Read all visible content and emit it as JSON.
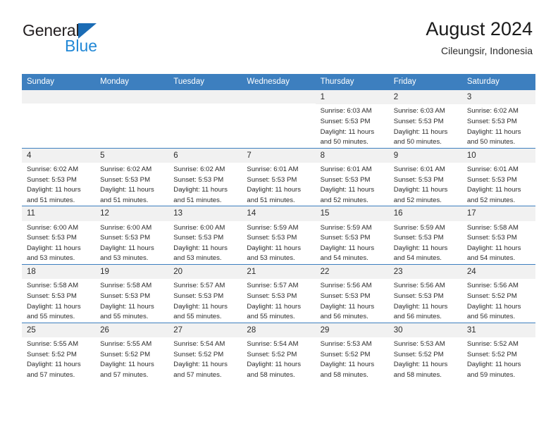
{
  "brand": {
    "name_part1": "General",
    "name_part2": "Blue",
    "accent_color": "#2288d6",
    "mark_color": "#1b6cb5"
  },
  "header": {
    "title": "August 2024",
    "subtitle": "Cileungsir, Indonesia"
  },
  "calendar": {
    "header_bg": "#3d7fbf",
    "daynum_bg": "#f1f1f1",
    "weekdays": [
      "Sunday",
      "Monday",
      "Tuesday",
      "Wednesday",
      "Thursday",
      "Friday",
      "Saturday"
    ],
    "weeks": [
      [
        {
          "day": "",
          "sunrise": "",
          "sunset": "",
          "daylight1": "",
          "daylight2": ""
        },
        {
          "day": "",
          "sunrise": "",
          "sunset": "",
          "daylight1": "",
          "daylight2": ""
        },
        {
          "day": "",
          "sunrise": "",
          "sunset": "",
          "daylight1": "",
          "daylight2": ""
        },
        {
          "day": "",
          "sunrise": "",
          "sunset": "",
          "daylight1": "",
          "daylight2": ""
        },
        {
          "day": "1",
          "sunrise": "Sunrise: 6:03 AM",
          "sunset": "Sunset: 5:53 PM",
          "daylight1": "Daylight: 11 hours",
          "daylight2": "and 50 minutes."
        },
        {
          "day": "2",
          "sunrise": "Sunrise: 6:03 AM",
          "sunset": "Sunset: 5:53 PM",
          "daylight1": "Daylight: 11 hours",
          "daylight2": "and 50 minutes."
        },
        {
          "day": "3",
          "sunrise": "Sunrise: 6:02 AM",
          "sunset": "Sunset: 5:53 PM",
          "daylight1": "Daylight: 11 hours",
          "daylight2": "and 50 minutes."
        }
      ],
      [
        {
          "day": "4",
          "sunrise": "Sunrise: 6:02 AM",
          "sunset": "Sunset: 5:53 PM",
          "daylight1": "Daylight: 11 hours",
          "daylight2": "and 51 minutes."
        },
        {
          "day": "5",
          "sunrise": "Sunrise: 6:02 AM",
          "sunset": "Sunset: 5:53 PM",
          "daylight1": "Daylight: 11 hours",
          "daylight2": "and 51 minutes."
        },
        {
          "day": "6",
          "sunrise": "Sunrise: 6:02 AM",
          "sunset": "Sunset: 5:53 PM",
          "daylight1": "Daylight: 11 hours",
          "daylight2": "and 51 minutes."
        },
        {
          "day": "7",
          "sunrise": "Sunrise: 6:01 AM",
          "sunset": "Sunset: 5:53 PM",
          "daylight1": "Daylight: 11 hours",
          "daylight2": "and 51 minutes."
        },
        {
          "day": "8",
          "sunrise": "Sunrise: 6:01 AM",
          "sunset": "Sunset: 5:53 PM",
          "daylight1": "Daylight: 11 hours",
          "daylight2": "and 52 minutes."
        },
        {
          "day": "9",
          "sunrise": "Sunrise: 6:01 AM",
          "sunset": "Sunset: 5:53 PM",
          "daylight1": "Daylight: 11 hours",
          "daylight2": "and 52 minutes."
        },
        {
          "day": "10",
          "sunrise": "Sunrise: 6:01 AM",
          "sunset": "Sunset: 5:53 PM",
          "daylight1": "Daylight: 11 hours",
          "daylight2": "and 52 minutes."
        }
      ],
      [
        {
          "day": "11",
          "sunrise": "Sunrise: 6:00 AM",
          "sunset": "Sunset: 5:53 PM",
          "daylight1": "Daylight: 11 hours",
          "daylight2": "and 53 minutes."
        },
        {
          "day": "12",
          "sunrise": "Sunrise: 6:00 AM",
          "sunset": "Sunset: 5:53 PM",
          "daylight1": "Daylight: 11 hours",
          "daylight2": "and 53 minutes."
        },
        {
          "day": "13",
          "sunrise": "Sunrise: 6:00 AM",
          "sunset": "Sunset: 5:53 PM",
          "daylight1": "Daylight: 11 hours",
          "daylight2": "and 53 minutes."
        },
        {
          "day": "14",
          "sunrise": "Sunrise: 5:59 AM",
          "sunset": "Sunset: 5:53 PM",
          "daylight1": "Daylight: 11 hours",
          "daylight2": "and 53 minutes."
        },
        {
          "day": "15",
          "sunrise": "Sunrise: 5:59 AM",
          "sunset": "Sunset: 5:53 PM",
          "daylight1": "Daylight: 11 hours",
          "daylight2": "and 54 minutes."
        },
        {
          "day": "16",
          "sunrise": "Sunrise: 5:59 AM",
          "sunset": "Sunset: 5:53 PM",
          "daylight1": "Daylight: 11 hours",
          "daylight2": "and 54 minutes."
        },
        {
          "day": "17",
          "sunrise": "Sunrise: 5:58 AM",
          "sunset": "Sunset: 5:53 PM",
          "daylight1": "Daylight: 11 hours",
          "daylight2": "and 54 minutes."
        }
      ],
      [
        {
          "day": "18",
          "sunrise": "Sunrise: 5:58 AM",
          "sunset": "Sunset: 5:53 PM",
          "daylight1": "Daylight: 11 hours",
          "daylight2": "and 55 minutes."
        },
        {
          "day": "19",
          "sunrise": "Sunrise: 5:58 AM",
          "sunset": "Sunset: 5:53 PM",
          "daylight1": "Daylight: 11 hours",
          "daylight2": "and 55 minutes."
        },
        {
          "day": "20",
          "sunrise": "Sunrise: 5:57 AM",
          "sunset": "Sunset: 5:53 PM",
          "daylight1": "Daylight: 11 hours",
          "daylight2": "and 55 minutes."
        },
        {
          "day": "21",
          "sunrise": "Sunrise: 5:57 AM",
          "sunset": "Sunset: 5:53 PM",
          "daylight1": "Daylight: 11 hours",
          "daylight2": "and 55 minutes."
        },
        {
          "day": "22",
          "sunrise": "Sunrise: 5:56 AM",
          "sunset": "Sunset: 5:53 PM",
          "daylight1": "Daylight: 11 hours",
          "daylight2": "and 56 minutes."
        },
        {
          "day": "23",
          "sunrise": "Sunrise: 5:56 AM",
          "sunset": "Sunset: 5:53 PM",
          "daylight1": "Daylight: 11 hours",
          "daylight2": "and 56 minutes."
        },
        {
          "day": "24",
          "sunrise": "Sunrise: 5:56 AM",
          "sunset": "Sunset: 5:52 PM",
          "daylight1": "Daylight: 11 hours",
          "daylight2": "and 56 minutes."
        }
      ],
      [
        {
          "day": "25",
          "sunrise": "Sunrise: 5:55 AM",
          "sunset": "Sunset: 5:52 PM",
          "daylight1": "Daylight: 11 hours",
          "daylight2": "and 57 minutes."
        },
        {
          "day": "26",
          "sunrise": "Sunrise: 5:55 AM",
          "sunset": "Sunset: 5:52 PM",
          "daylight1": "Daylight: 11 hours",
          "daylight2": "and 57 minutes."
        },
        {
          "day": "27",
          "sunrise": "Sunrise: 5:54 AM",
          "sunset": "Sunset: 5:52 PM",
          "daylight1": "Daylight: 11 hours",
          "daylight2": "and 57 minutes."
        },
        {
          "day": "28",
          "sunrise": "Sunrise: 5:54 AM",
          "sunset": "Sunset: 5:52 PM",
          "daylight1": "Daylight: 11 hours",
          "daylight2": "and 58 minutes."
        },
        {
          "day": "29",
          "sunrise": "Sunrise: 5:53 AM",
          "sunset": "Sunset: 5:52 PM",
          "daylight1": "Daylight: 11 hours",
          "daylight2": "and 58 minutes."
        },
        {
          "day": "30",
          "sunrise": "Sunrise: 5:53 AM",
          "sunset": "Sunset: 5:52 PM",
          "daylight1": "Daylight: 11 hours",
          "daylight2": "and 58 minutes."
        },
        {
          "day": "31",
          "sunrise": "Sunrise: 5:52 AM",
          "sunset": "Sunset: 5:52 PM",
          "daylight1": "Daylight: 11 hours",
          "daylight2": "and 59 minutes."
        }
      ]
    ]
  }
}
